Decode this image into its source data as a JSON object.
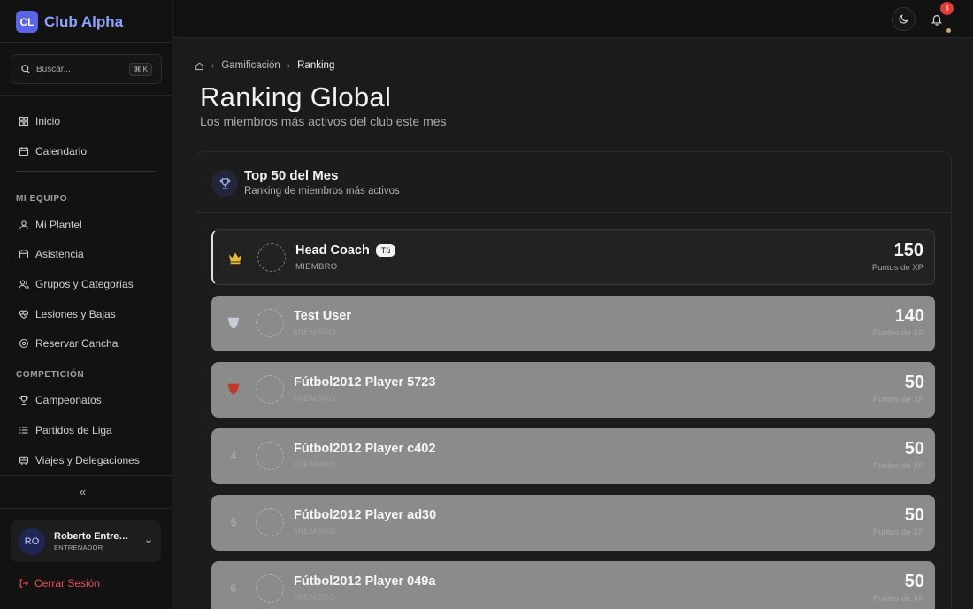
{
  "brand": {
    "logo": "CL",
    "name": "Club Alpha"
  },
  "search": {
    "placeholder": "Buscar...",
    "shortcut": "⌘ K"
  },
  "nav": {
    "top": [
      {
        "label": "Inicio",
        "icon": "grid-icon"
      },
      {
        "label": "Calendario",
        "icon": "calendar-icon"
      }
    ],
    "sections": [
      {
        "title": "MI EQUIPO",
        "items": [
          {
            "label": "Mi Plantel",
            "icon": "user-icon"
          },
          {
            "label": "Asistencia",
            "icon": "calendar-check-icon"
          },
          {
            "label": "Grupos y Categorías",
            "icon": "users-icon"
          },
          {
            "label": "Lesiones y Bajas",
            "icon": "heart-pulse-icon"
          },
          {
            "label": "Reservar Cancha",
            "icon": "target-icon"
          }
        ]
      },
      {
        "title": "COMPETICIÓN",
        "items": [
          {
            "label": "Campeonatos",
            "icon": "trophy-icon"
          },
          {
            "label": "Partidos de Liga",
            "icon": "list-icon"
          },
          {
            "label": "Viajes y Delegaciones",
            "icon": "bus-icon"
          }
        ]
      }
    ],
    "collapse": "«"
  },
  "user": {
    "initials": "RO",
    "name": "Roberto Entrenador",
    "role": "ENTRENADOR"
  },
  "logout": "Cerrar Sesión",
  "topbar": {
    "notifications": "3"
  },
  "breadcrumb": {
    "parent": "Gamificación",
    "current": "Ranking"
  },
  "page": {
    "title": "Ranking Global",
    "subtitle": "Los miembros más activos del club este mes"
  },
  "card": {
    "title": "Top 50 del Mes",
    "subtitle": "Ranking de miembros más activos"
  },
  "ranking": [
    {
      "rank": "1",
      "name": "Head Coach",
      "badge": "Tú",
      "role": "MIEMBRO",
      "xp": "150",
      "xp_label": "Puntos de XP"
    },
    {
      "rank": "2",
      "name": "Test User",
      "role": "MIEMBRO",
      "xp": "140",
      "xp_label": "Puntos de XP"
    },
    {
      "rank": "3",
      "name": "Fútbol2012 Player 5723",
      "role": "MIEMBRO",
      "xp": "50",
      "xp_label": "Puntos de XP"
    },
    {
      "rank": "4",
      "name": "Fútbol2012 Player c402",
      "role": "MIEMBRO",
      "xp": "50",
      "xp_label": "Puntos de XP"
    },
    {
      "rank": "5",
      "name": "Fútbol2012 Player ad30",
      "role": "MIEMBRO",
      "xp": "50",
      "xp_label": "Puntos de XP"
    },
    {
      "rank": "6",
      "name": "Fútbol2012 Player 049a",
      "role": "MIEMBRO",
      "xp": "50",
      "xp_label": "Puntos de XP"
    }
  ],
  "colors": {
    "accent": "#5b63e8",
    "gold": "#e5b73b",
    "silver": "#c7cdd8",
    "bronze": "#c0392b",
    "danger": "#f05252"
  }
}
